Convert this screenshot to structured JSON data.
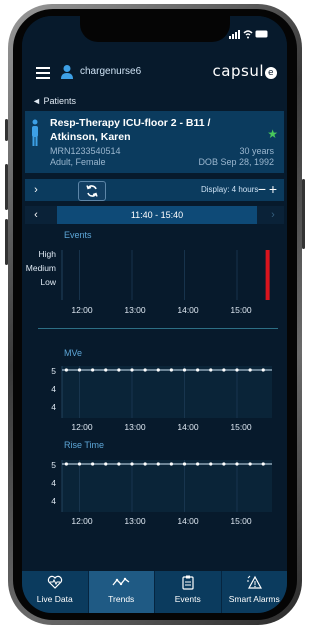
{
  "header": {
    "username": "chargenurse6",
    "logo_text": "capsul",
    "logo_mark": "e"
  },
  "nav": {
    "back_label": "Patients"
  },
  "patient": {
    "name": "Resp-Therapy ICU-floor 2 - B11 / Atkinson, Karen",
    "mrn": "MRN1233540514",
    "demographics": "Adult, Female",
    "age": "30 years",
    "dob": "DOB Sep 28, 1992",
    "favorite": true
  },
  "controls": {
    "display_label": "Display: 4 hours",
    "minus_label": "−",
    "plus_label": "+"
  },
  "range": {
    "label": "11:40 - 15:40"
  },
  "charts": [
    {
      "title": "Events",
      "y_ticks": [
        "High",
        "Medium",
        "Low"
      ],
      "x_ticks": [
        "12:00",
        "13:00",
        "14:00",
        "15:00"
      ]
    },
    {
      "title": "MVe",
      "y_ticks": [
        "5",
        "4",
        "4"
      ],
      "x_ticks": [
        "12:00",
        "13:00",
        "14:00",
        "15:00"
      ]
    },
    {
      "title": "Rise Time",
      "y_ticks": [
        "5",
        "4",
        "4"
      ],
      "x_ticks": [
        "12:00",
        "13:00",
        "14:00",
        "15:00"
      ]
    }
  ],
  "chart_data": [
    {
      "type": "bar",
      "title": "Events",
      "x": [
        "15:35"
      ],
      "values": [
        "High"
      ],
      "y_categories": [
        "Low",
        "Medium",
        "High"
      ],
      "color": "#d9141e"
    },
    {
      "type": "line",
      "title": "MVe",
      "x": [
        "11:45",
        "12:00",
        "12:15",
        "12:30",
        "12:45",
        "13:00",
        "13:15",
        "13:30",
        "13:45",
        "14:00",
        "14:15",
        "14:30",
        "14:45",
        "15:00",
        "15:15",
        "15:30"
      ],
      "values": [
        5,
        5,
        5,
        5,
        5,
        5,
        5,
        5,
        5,
        5,
        5,
        5,
        5,
        5,
        5,
        5
      ]
    },
    {
      "type": "line",
      "title": "Rise Time",
      "x": [
        "11:45",
        "12:00",
        "12:15",
        "12:30",
        "12:45",
        "13:00",
        "13:15",
        "13:30",
        "13:45",
        "14:00",
        "14:15",
        "14:30",
        "14:45",
        "15:00",
        "15:15",
        "15:30"
      ],
      "values": [
        5,
        5,
        5,
        5,
        5,
        5,
        5,
        5,
        5,
        5,
        5,
        5,
        5,
        5,
        5,
        5
      ]
    }
  ],
  "tabs": [
    {
      "label": "Live Data",
      "icon": "heart-monitor-icon",
      "active": false
    },
    {
      "label": "Trends",
      "icon": "trend-line-icon",
      "active": true
    },
    {
      "label": "Events",
      "icon": "clipboard-icon",
      "active": false
    },
    {
      "label": "Smart Alarms",
      "icon": "alarm-warning-icon",
      "active": false
    }
  ],
  "colors": {
    "background": "#071a2c",
    "panel": "#0b3b5e",
    "accent": "#5da6d7",
    "event_high": "#d9141e",
    "favorite": "#49c95b"
  }
}
